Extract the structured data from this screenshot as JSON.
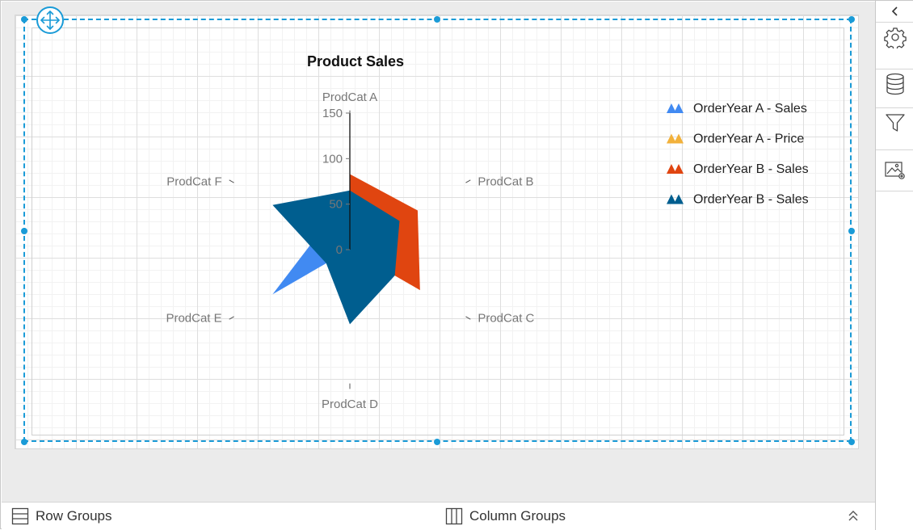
{
  "panel": {
    "collapse_icon": "chevron-left-icon",
    "buttons": [
      {
        "name": "settings",
        "icon": "gear-icon"
      },
      {
        "name": "data",
        "icon": "database-icon"
      },
      {
        "name": "filter",
        "icon": "filter-icon"
      },
      {
        "name": "image-settings",
        "icon": "image-settings-icon"
      }
    ]
  },
  "bottom_bar": {
    "row_groups_label": "Row Groups",
    "column_groups_label": "Column Groups"
  },
  "chart_data": {
    "type": "radar",
    "title": "Product Sales",
    "categories": [
      "ProdCat A",
      "ProdCat B",
      "ProdCat C",
      "ProdCat D",
      "ProdCat E",
      "ProdCat F"
    ],
    "radial_ticks": [
      0,
      50,
      100,
      150
    ],
    "rlim": [
      0,
      150
    ],
    "legend_position": "top-right",
    "series": [
      {
        "name": "OrderYear A - Sales",
        "color": "#418af2",
        "values": [
          null,
          null,
          null,
          null,
          98,
          38
        ]
      },
      {
        "name": "OrderYear A - Price",
        "color": "#f2b13b",
        "values": [
          null,
          null,
          null,
          null,
          null,
          null
        ]
      },
      {
        "name": "OrderYear B - Sales",
        "color": "#e04510",
        "values": [
          83,
          86,
          89,
          0,
          0,
          0
        ]
      },
      {
        "name": "OrderYear B - Sales",
        "color": "#005e8f",
        "values": [
          65,
          63,
          57,
          82,
          30,
          98
        ]
      }
    ]
  }
}
